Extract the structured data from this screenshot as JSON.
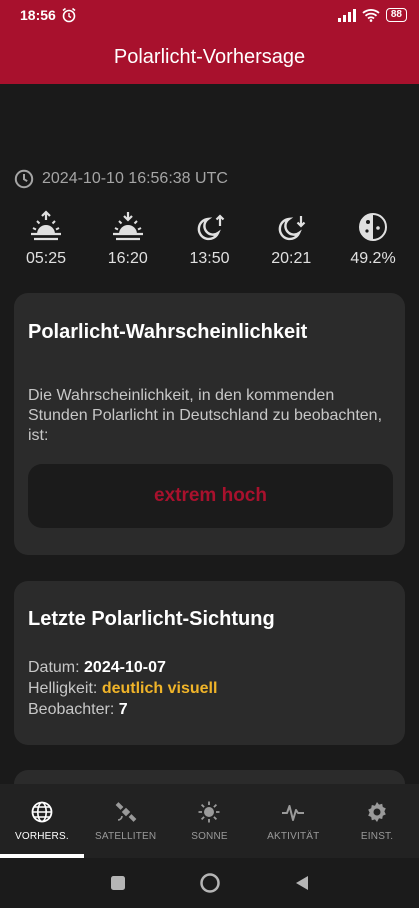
{
  "status": {
    "time": "18:56",
    "battery": "88"
  },
  "app": {
    "title": "Polarlicht-Vorhersage"
  },
  "timestamp": "2024-10-10 16:56:38 UTC",
  "astro": [
    {
      "icon": "sunrise-icon",
      "value": "05:25"
    },
    {
      "icon": "sunset-icon",
      "value": "16:20"
    },
    {
      "icon": "moonrise-icon",
      "value": "13:50"
    },
    {
      "icon": "moonset-icon",
      "value": "20:21"
    },
    {
      "icon": "moon-phase-icon",
      "value": "49.2%"
    }
  ],
  "probability": {
    "title": "Polarlicht-Wahrscheinlichkeit",
    "description": "Die Wahrscheinlichkeit, in den kommenden Stunden Polarlicht in Deutschland zu beobachten, ist:",
    "level": "extrem hoch",
    "level_color": "#a8112d"
  },
  "sighting": {
    "title": "Letzte Polarlicht-Sichtung",
    "date_label": "Datum:",
    "date_value": "2024-10-07",
    "brightness_label": "Helligkeit:",
    "brightness_value": "deutlich visuell",
    "observers_label": "Beobachter:",
    "observers_value": "7"
  },
  "nav": [
    {
      "label": "VORHERS.",
      "icon": "globe-icon",
      "active": true
    },
    {
      "label": "SATELLITEN",
      "icon": "satellite-icon",
      "active": false
    },
    {
      "label": "SONNE",
      "icon": "sun-icon",
      "active": false
    },
    {
      "label": "AKTIVITÄT",
      "icon": "activity-icon",
      "active": false
    },
    {
      "label": "EINST.",
      "icon": "gear-icon",
      "active": false
    }
  ],
  "colors": {
    "brand": "#a8112d",
    "highlight": "#f0b429",
    "background": "#1a1a1a",
    "card": "#2b2b2b"
  }
}
